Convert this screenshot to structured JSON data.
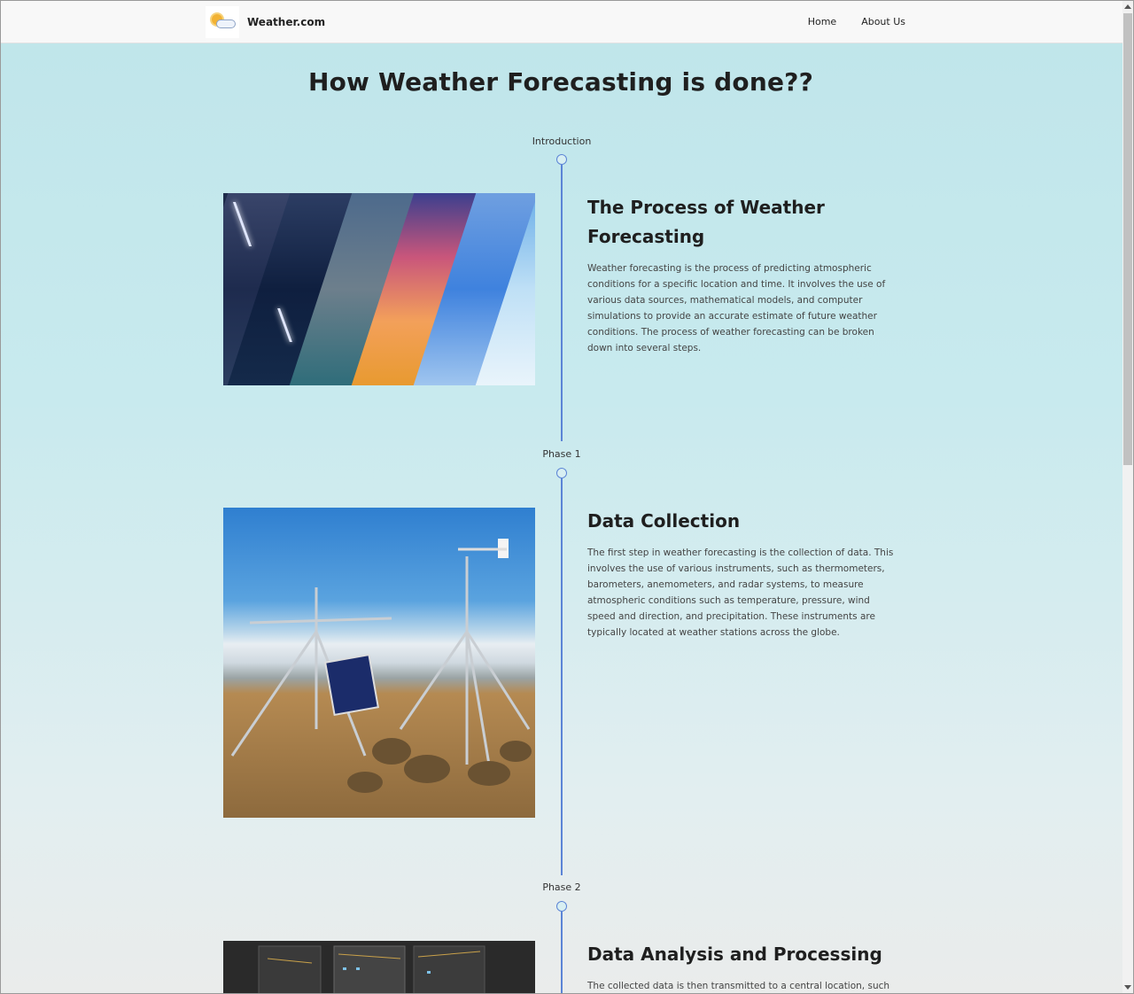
{
  "navbar": {
    "brand": "Weather.com",
    "links": [
      "Home",
      "About Us"
    ]
  },
  "page_title": "How Weather Forecasting is done??",
  "sections": [
    {
      "phase": "Introduction",
      "title": "The Process of Weather Forecasting",
      "body": "Weather forecasting is the process of predicting atmospheric conditions for a specific location and time. It involves the use of various data sources, mathematical models, and computer simulations to provide an accurate estimate of future weather conditions. The process of weather forecasting can be broken down into several steps.",
      "image": "weather-collage"
    },
    {
      "phase": "Phase 1",
      "title": "Data Collection",
      "body": "The first step in weather forecasting is the collection of data. This involves the use of various instruments, such as thermometers, barometers, anemometers, and radar systems, to measure atmospheric conditions such as temperature, pressure, wind speed and direction, and precipitation. These instruments are typically located at weather stations across the globe.",
      "image": "weather-station"
    },
    {
      "phase": "Phase 2",
      "title": "Data Analysis and Processing",
      "body": "The collected data is then transmitted to a central location, such as a",
      "image": "server-rack"
    }
  ],
  "colors": {
    "timeline": "#5b84d6",
    "title": "#1f1f1f"
  }
}
